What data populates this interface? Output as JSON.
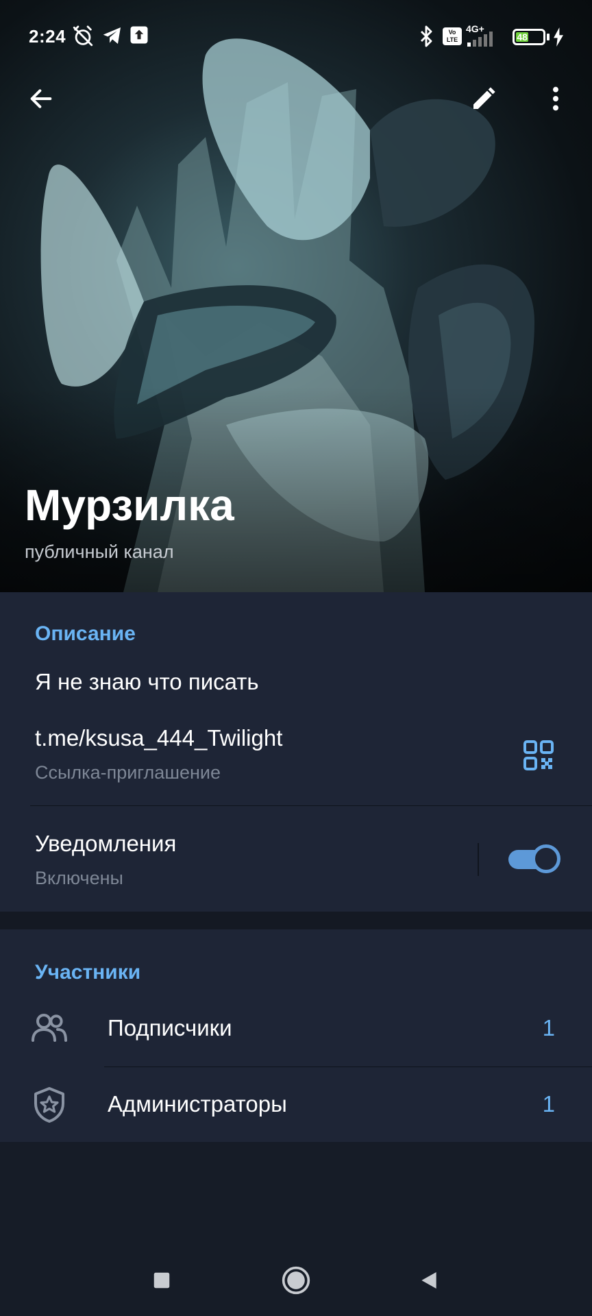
{
  "status_bar": {
    "time": "2:24",
    "network": "4G+",
    "volte": "Vo LTE",
    "battery": "48"
  },
  "header": {
    "channel_name": "Мурзилка",
    "channel_type": "публичный канал",
    "icons": [
      "arrow-left-icon",
      "pencil-icon",
      "more-vertical-icon"
    ]
  },
  "info": {
    "section_title": "Описание",
    "description": "Я не знаю что писать",
    "link": "t.me/ksusa_444_Twilight",
    "link_caption": "Ссылка-приглашение",
    "notifications_label": "Уведомления",
    "notifications_status": "Включены",
    "notifications_on": true
  },
  "members": {
    "section_title": "Участники",
    "rows": [
      {
        "label": "Подписчики",
        "count": "1",
        "icon": "people-icon"
      },
      {
        "label": "Администраторы",
        "count": "1",
        "icon": "admin-shield-icon"
      }
    ]
  },
  "colors": {
    "accent": "#6ab4f4",
    "card_bg": "#1e2536",
    "page_bg": "#161c27",
    "toggle": "#5d99d8",
    "battery": "#6fd13a"
  }
}
